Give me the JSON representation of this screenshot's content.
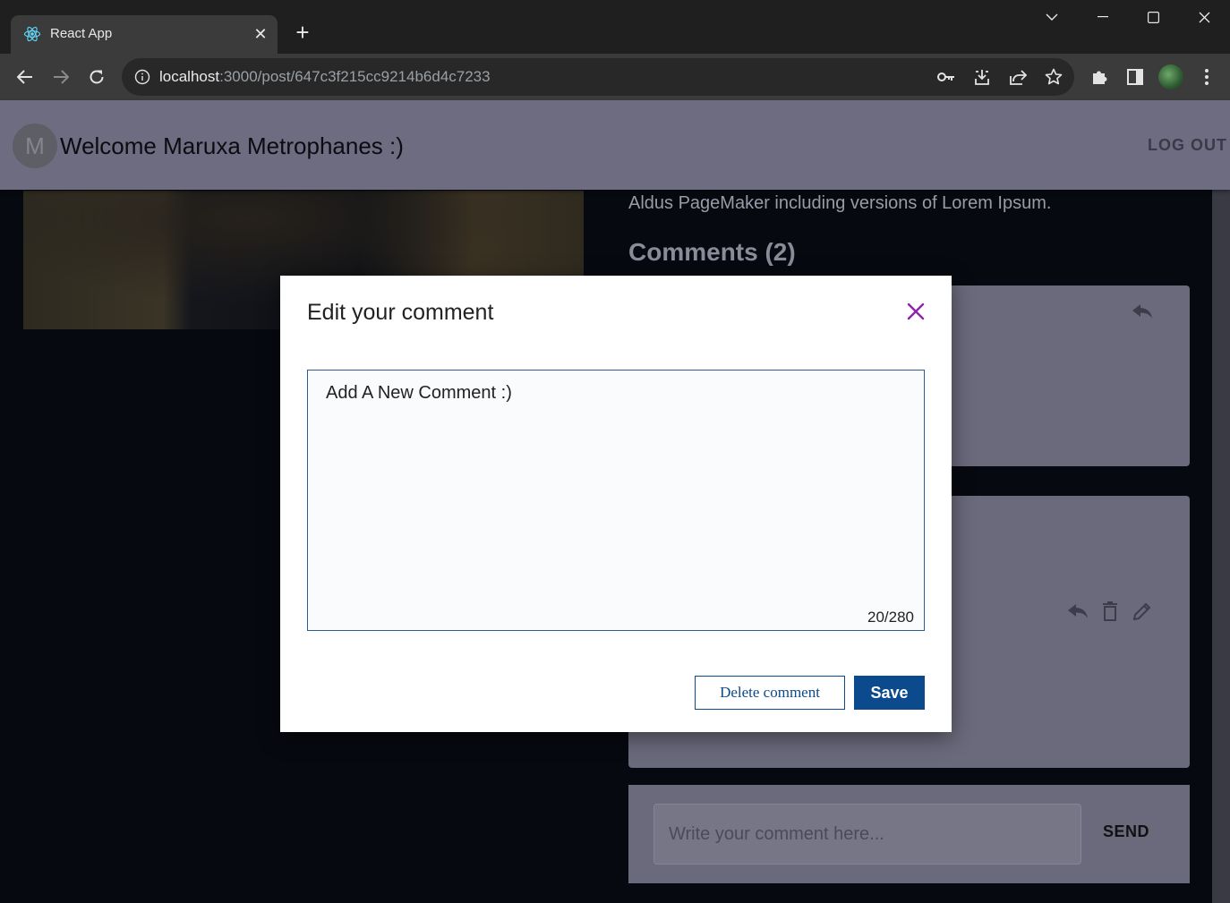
{
  "browser": {
    "tab_title": "React App",
    "url_host": "localhost",
    "url_path": ":3000/post/647c3f215cc9214b6d4c7233"
  },
  "header": {
    "avatar_initial": "M",
    "welcome": "Welcome Maruxa Metrophanes :)",
    "logout_label": "LOG OUT"
  },
  "post": {
    "text_fragment": "Aldus PageMaker including versions of Lorem Ipsum.",
    "comments_heading": "Comments (2)"
  },
  "comment_form": {
    "placeholder": "Write your comment here...",
    "send_label": "SEND"
  },
  "modal": {
    "title": "Edit your comment",
    "comment_value": "Add A New Comment :)",
    "char_count": "20/280",
    "delete_label": "Delete comment",
    "save_label": "Save"
  },
  "colors": {
    "accent": "#0b4a8c",
    "close": "#8e24aa",
    "header_bg": "#6d6c80",
    "page_bg": "#070910"
  },
  "icons": {
    "modal_close": "close-icon",
    "reply": "reply-icon",
    "delete": "trash-icon",
    "edit": "pencil-icon"
  }
}
